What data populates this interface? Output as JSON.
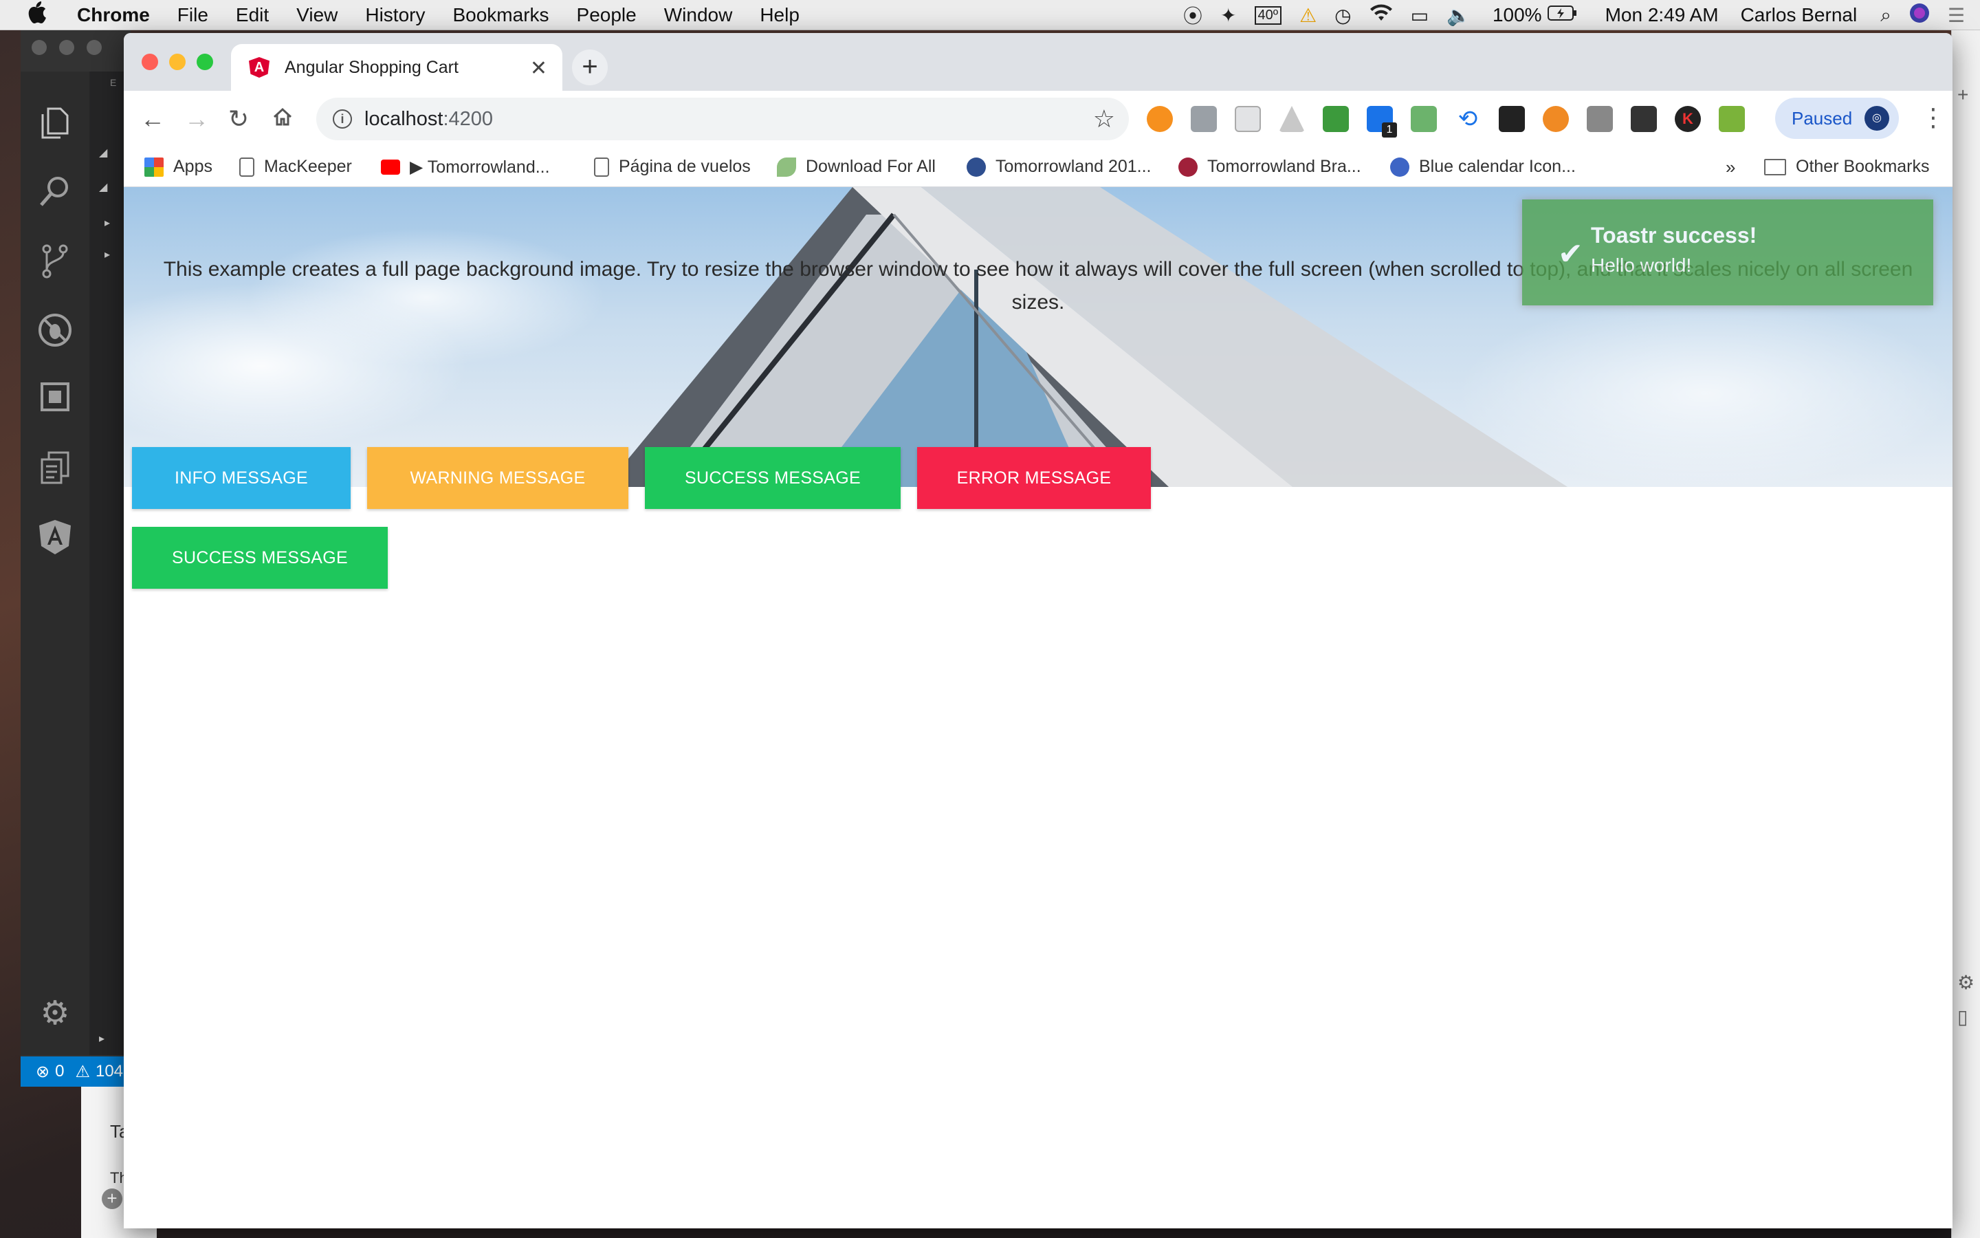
{
  "menubar": {
    "app_name": "Chrome",
    "items": [
      "File",
      "Edit",
      "View",
      "History",
      "Bookmarks",
      "People",
      "Window",
      "Help"
    ],
    "battery": "100%",
    "clock": "Mon 2:49 AM",
    "user": "Carlos Bernal",
    "temp_badge": "40º"
  },
  "vscode": {
    "errors": "0",
    "warnings": "104"
  },
  "chrome": {
    "tab_title": "Angular Shopping Cart",
    "url_host": "localhost",
    "url_port": ":4200",
    "profile_status": "Paused",
    "ext_badge": "1",
    "bookmarks": [
      {
        "label": "Apps"
      },
      {
        "label": "MacKeeper"
      },
      {
        "label": "▶ Tomorrowland..."
      },
      {
        "label": "Página de vuelos"
      },
      {
        "label": "Download For All"
      },
      {
        "label": "Tomorrowland 201..."
      },
      {
        "label": "Tomorrowland Bra..."
      },
      {
        "label": "Blue calendar Icon..."
      }
    ],
    "bookmarks_overflow": "»",
    "other_bookmarks": "Other Bookmarks"
  },
  "page": {
    "hero_text": "This example creates a full page background image. Try to resize the browser window to see how it always will cover the full screen (when scrolled to top), and that it scales nicely on all screen sizes.",
    "buttons": [
      {
        "label": "INFO MESSAGE",
        "color": "#2fb4e8"
      },
      {
        "label": "WARNING MESSAGE",
        "color": "#fbb740"
      },
      {
        "label": "SUCCESS MESSAGE",
        "color": "#1ec75c"
      },
      {
        "label": "ERROR MESSAGE",
        "color": "#f5234a"
      },
      {
        "label": "SUCCESS MESSAGE",
        "color": "#1ec75c"
      }
    ]
  },
  "toast": {
    "title": "Toastr success!",
    "message": "Hello world!",
    "color": "#51a351"
  }
}
